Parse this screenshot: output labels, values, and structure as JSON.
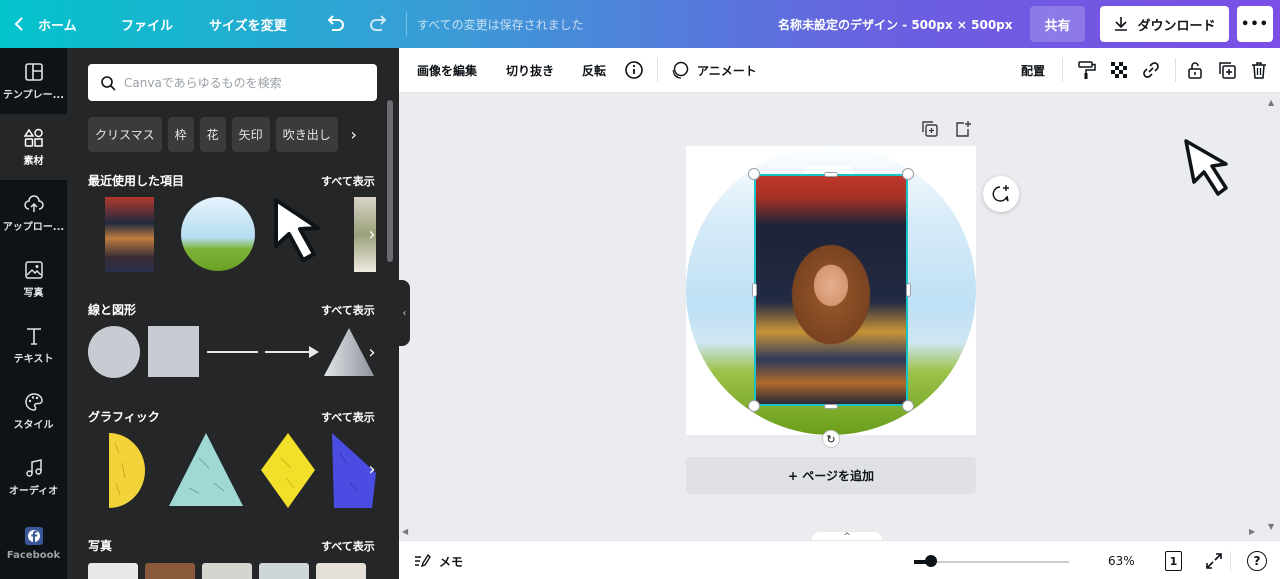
{
  "topbar": {
    "home_label": "ホーム",
    "file_label": "ファイル",
    "resize_label": "サイズを変更",
    "saved_status": "すべての変更は保存されました",
    "doc_name": "名称未設定のデザイン - 500px × 500px",
    "share_label": "共有",
    "download_label": "ダウンロード",
    "more_label": "•••"
  },
  "rail": {
    "items": [
      {
        "label": "テンプレー...",
        "icon": "templates-icon"
      },
      {
        "label": "素材",
        "icon": "elements-icon"
      },
      {
        "label": "アップロー...",
        "icon": "upload-icon"
      },
      {
        "label": "写真",
        "icon": "photo-icon"
      },
      {
        "label": "テキスト",
        "icon": "text-icon"
      },
      {
        "label": "スタイル",
        "icon": "palette-icon"
      },
      {
        "label": "オーディオ",
        "icon": "audio-icon"
      },
      {
        "label": "Facebook",
        "icon": "facebook-icon"
      }
    ]
  },
  "panel": {
    "search_placeholder": "Canvaであらゆるものを検索",
    "chips": [
      "クリスマス",
      "枠",
      "花",
      "矢印",
      "吹き出し"
    ],
    "sections": {
      "recent": {
        "title": "最近使用した項目",
        "see_all": "すべて表示"
      },
      "shapes": {
        "title": "線と図形",
        "see_all": "すべて表示"
      },
      "graphics": {
        "title": "グラフィック",
        "see_all": "すべて表示"
      },
      "photos": {
        "title": "写真",
        "see_all": "すべて表示"
      }
    }
  },
  "editor_toolbar": {
    "edit_image": "画像を編集",
    "crop": "切り抜き",
    "flip": "反転",
    "animate": "アニメート",
    "position": "配置"
  },
  "canvas": {
    "add_page": "+ ページを追加"
  },
  "bottombar": {
    "notes": "メモ",
    "zoom": "63%",
    "page_count": "1",
    "help": "?"
  },
  "colors": {
    "selection": "#19c4c6",
    "rail_bg": "#0e1318",
    "panel_bg": "#252627"
  }
}
